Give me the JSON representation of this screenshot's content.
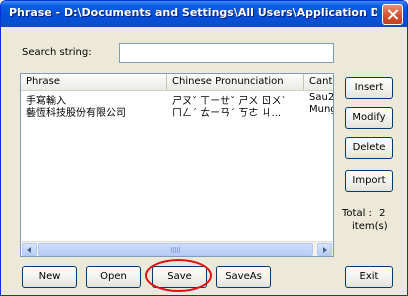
{
  "window": {
    "title": "Phrase - D:\\Documents and Settings\\All Users\\Application Dat..."
  },
  "search": {
    "label": "Search string:",
    "value": ""
  },
  "list": {
    "columns": [
      "Phrase",
      "Chinese Pronunciation",
      "Canto"
    ],
    "rows": [
      [
        "手寫輸入",
        "ㄕㄡˇ ㄒㄧㄝˇ ㄕㄨ ㄖㄨˋ",
        "Sau2"
      ],
      [
        "藝恆科技股份有限公司",
        "ㄇㄥˊ ㄊㄧㄢˊ ㄎㄜ ㄐ...",
        "Mung"
      ]
    ]
  },
  "side_buttons": {
    "insert": "Insert",
    "modify": "Modify",
    "delete": "Delete",
    "import": "Import",
    "exit": "Exit"
  },
  "total": {
    "label": "Total :",
    "count": "2",
    "unit": "item(s)"
  },
  "bottom_buttons": {
    "new": "New",
    "open": "Open",
    "save": "Save",
    "saveas": "SaveAs"
  },
  "colors": {
    "titlebar": "#0050dc",
    "highlight": "#e01010"
  }
}
